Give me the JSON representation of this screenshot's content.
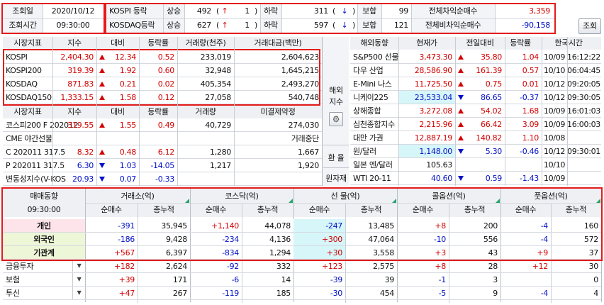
{
  "top": {
    "date_label": "조회일",
    "date_value": "2020/10/12",
    "time_label": "조회시간",
    "time_value": "09:30:00",
    "rows": [
      {
        "name": "KOSPI 등락",
        "up_label": "상승",
        "up_value": "492",
        "up_paren": "(",
        "up_icon": "↑",
        "up_count": "1",
        "up_close": ")",
        "down_label": "하락",
        "down_value": "311",
        "down_paren": "(",
        "down_icon": "↓",
        "down_close": ")",
        "flat_label": "보합",
        "flat_value": "99",
        "arb_label": "전체차익순매수",
        "arb_value": "3,359"
      },
      {
        "name": "KOSDAQ등락",
        "up_label": "상승",
        "up_value": "627",
        "up_paren": "(",
        "up_icon": "↑",
        "up_count": "1",
        "up_close": ")",
        "down_label": "하락",
        "down_value": "597",
        "down_paren": "(",
        "down_icon": "↓",
        "down_close": ")",
        "flat_label": "보합",
        "flat_value": "121",
        "arb_label": "전체비차익순매수",
        "arb_value": "-90,158"
      }
    ],
    "refresh_button": "조회"
  },
  "market": {
    "headers": [
      "시장지표",
      "지수",
      "대비",
      "등락률",
      "거래량(천주)",
      "거래대금(백만)"
    ],
    "rows": [
      {
        "name": "KOSPI",
        "index": "2,404.30",
        "change": "12.34",
        "dir": "up",
        "rate": "0.52",
        "volume": "233,019",
        "amount": "2,604,623"
      },
      {
        "name": "KOSPI200",
        "index": "319.39",
        "change": "1.92",
        "dir": "up",
        "rate": "0.60",
        "volume": "32,948",
        "amount": "1,645,215"
      },
      {
        "name": "KOSDAQ",
        "index": "871.83",
        "change": "0.21",
        "dir": "up",
        "rate": "0.02",
        "volume": "405,354",
        "amount": "2,493,270"
      },
      {
        "name": "KOSDAQ150",
        "index": "1,333.15",
        "change": "1.58",
        "dir": "up",
        "rate": "0.12",
        "volume": "27,058",
        "amount": "540,748"
      }
    ],
    "headers2": [
      "시장지표",
      "지수",
      "대비",
      "등락률",
      "거래량",
      "미결제약정"
    ],
    "rows2": [
      {
        "name": "코스피200 F 202012",
        "index": "319.55",
        "change": "1.55",
        "dir": "up",
        "rate": "0.49",
        "volume": "40,729",
        "oi": "274,030",
        "color": "red"
      },
      {
        "name": "CME 야간선물",
        "index": "",
        "change": "",
        "dir": "",
        "rate": "",
        "volume": "",
        "oi": "거래중단",
        "color": ""
      },
      {
        "name": "C 202011 317.5",
        "index": "8.32",
        "change": "0.48",
        "dir": "up",
        "rate": "6.12",
        "volume": "1,280",
        "oi": "1,667",
        "color": "red"
      },
      {
        "name": "P 202011 317.5",
        "index": "6.30",
        "change": "1.03",
        "dir": "dn",
        "rate": "-14.05",
        "volume": "1,217",
        "oi": "1,920",
        "color": "blue"
      },
      {
        "name": "변동성지수(V-KOS",
        "index": "20.93",
        "change": "0.07",
        "dir": "dn",
        "rate": "-0.33",
        "volume": "",
        "oi": "",
        "color": "blue"
      }
    ]
  },
  "side": {
    "overseas_label": "해외\n지수",
    "overseas_line1": "해외",
    "overseas_line2": "지수",
    "fx_label": "환 율",
    "commodity_label": "원자재"
  },
  "overseas": {
    "headers": [
      "해외동향",
      "현재가",
      "전일대비",
      "등락률",
      "한국시간"
    ],
    "rows": [
      {
        "name": "S&P500 선물",
        "price": "3,473.30",
        "change": "35.80",
        "dir": "up",
        "rate": "1.04",
        "date": "10/09",
        "time": "16:12:22",
        "hl": false
      },
      {
        "name": "다우 산업",
        "price": "28,586.90",
        "change": "161.39",
        "dir": "up",
        "rate": "0.57",
        "date": "10/10",
        "time": "06:04:45",
        "hl": false
      },
      {
        "name": "E-Mini 나스",
        "price": "11,725.50",
        "change": "0.75",
        "dir": "up",
        "rate": "0.01",
        "date": "10/12",
        "time": "09:20:05",
        "hl": false
      },
      {
        "name": "니케이225",
        "price": "23,533.04",
        "change": "86.65",
        "dir": "dn",
        "rate": "-0.37",
        "date": "10/12",
        "time": "09:30:05",
        "hl": true
      },
      {
        "name": "상해종합",
        "price": "3,272.08",
        "change": "54.02",
        "dir": "up",
        "rate": "1.68",
        "date": "10/09",
        "time": "16:01:03",
        "hl": false
      },
      {
        "name": "심천종합지수",
        "price": "2,215.96",
        "change": "66.42",
        "dir": "up",
        "rate": "3.09",
        "date": "10/09",
        "time": "16:00:03",
        "hl": false
      },
      {
        "name": "대만 가권",
        "price": "12,887.19",
        "change": "140.82",
        "dir": "up",
        "rate": "1.10",
        "date": "10/08",
        "time": "",
        "hl": false
      },
      {
        "name": "원/달러",
        "price": "1,148.00",
        "change": "5.30",
        "dir": "dn",
        "rate": "-0.46",
        "date": "10/12",
        "time": "09:30:01",
        "hl": true
      },
      {
        "name": "일본 엔/달러",
        "price": "105.63",
        "change": "",
        "dir": "",
        "rate": "",
        "date": "10/10",
        "time": "",
        "hl": false
      },
      {
        "name": "WTI 20-11",
        "price": "40.60",
        "change": "0.59",
        "dir": "dn",
        "rate": "-1.43",
        "date": "10/09",
        "time": "",
        "hl": false
      }
    ]
  },
  "investor": {
    "title": "매매동향",
    "time": "09:30:00",
    "groups": [
      "거래소(억)",
      "코스닥(억)",
      "선  물(억)",
      "콜옵션(억)",
      "풋옵션(억)"
    ],
    "sub_net": "순매수",
    "sub_total": "총누적",
    "rows": [
      {
        "name": "개인",
        "vals": [
          "-391",
          "35,945",
          "+1,140",
          "44,078",
          "-247",
          "13,485",
          "+8",
          "200",
          "-4",
          "160"
        ],
        "bg": "pink",
        "dropdown": false
      },
      {
        "name": "외국인",
        "vals": [
          "-186",
          "9,428",
          "-234",
          "4,136",
          "+300",
          "47,064",
          "-10",
          "556",
          "-4",
          "572"
        ],
        "bg": "green",
        "dropdown": false
      },
      {
        "name": "기관계",
        "vals": [
          "+567",
          "6,397",
          "-834",
          "1,294",
          "+30",
          "3,558",
          "+3",
          "43",
          "+9",
          "37"
        ],
        "bg": "green",
        "dropdown": false
      },
      {
        "name": "금융투자",
        "vals": [
          "+182",
          "2,624",
          "-92",
          "332",
          "+123",
          "2,575",
          "+8",
          "28",
          "+12",
          "30"
        ],
        "bg": "",
        "dropdown": true
      },
      {
        "name": "보험",
        "vals": [
          "+39",
          "171",
          "-6",
          "14",
          "-39",
          "39",
          "-1",
          "3",
          "",
          "0"
        ],
        "bg": "",
        "dropdown": true
      },
      {
        "name": "투신",
        "vals": [
          "+47",
          "267",
          "-119",
          "185",
          "-30",
          "454",
          "-5",
          "9",
          "-4",
          "4"
        ],
        "bg": "",
        "dropdown": true
      }
    ]
  },
  "colors": {
    "up": "#d40000",
    "down": "#0010c8",
    "highlight_box": "#e41b1b",
    "cyan": "#d6f6fa"
  }
}
